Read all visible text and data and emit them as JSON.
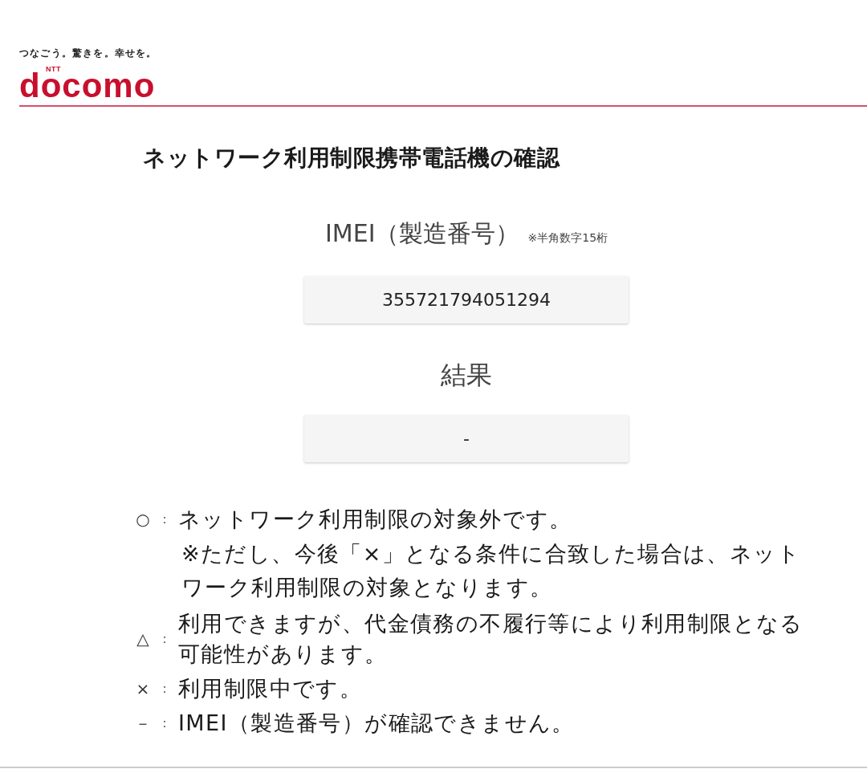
{
  "header": {
    "tagline": "つなごう。驚きを。幸せを。",
    "logo": {
      "mark": "NTT",
      "wordmark": "docomo"
    }
  },
  "title": "ネットワーク利用制限携帯電話機の確認",
  "imei": {
    "label": "IMEI（製造番号）",
    "hint": "※半角数字15桁",
    "value": "355721794051294"
  },
  "result": {
    "label": "結果",
    "value": "-"
  },
  "legend": [
    {
      "symbol": "○",
      "colon": "：",
      "text": "ネットワーク利用制限の対象外です。",
      "note": "※ただし、今後「×」となる条件に合致した場合は、ネットワーク利用制限の対象となります。"
    },
    {
      "symbol": "△",
      "colon": "：",
      "text": "利用できますが、代金債務の不履行等により利用制限となる可能性があります。"
    },
    {
      "symbol": "×",
      "colon": "：",
      "text": "利用制限中です。"
    },
    {
      "symbol": "－",
      "colon": "：",
      "text": "IMEI（製造番号）が確認できません。"
    }
  ]
}
